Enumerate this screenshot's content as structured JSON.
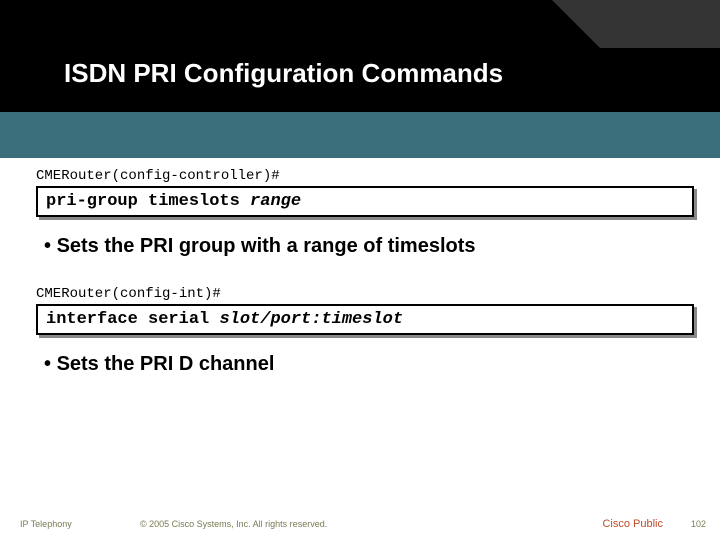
{
  "title": "ISDN PRI Configuration Commands",
  "block1": {
    "prompt": "CMERouter(config-controller)#",
    "cmd_fixed": "pri-group timeslots ",
    "cmd_arg": "range",
    "bullet": "Sets the PRI group with a range of timeslots"
  },
  "block2": {
    "prompt": "CMERouter(config-int)#",
    "cmd_fixed": "interface serial ",
    "cmd_arg": "slot/port:timeslot",
    "bullet": "Sets the PRI D channel"
  },
  "footer": {
    "course": "IP Telephony",
    "copyright": "© 2005 Cisco Systems, Inc. All rights reserved.",
    "public": "Cisco Public",
    "page": "102"
  }
}
